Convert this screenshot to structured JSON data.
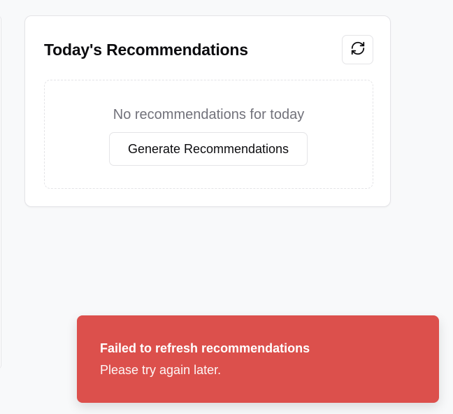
{
  "recommendations_card": {
    "title": "Today's Recommendations",
    "refresh_icon": "refresh-icon",
    "empty_message": "No recommendations for today",
    "generate_label": "Generate Recommendations"
  },
  "toast": {
    "title": "Failed to refresh recommendations",
    "message": "Please try again later.",
    "background_color": "#dc504c"
  }
}
